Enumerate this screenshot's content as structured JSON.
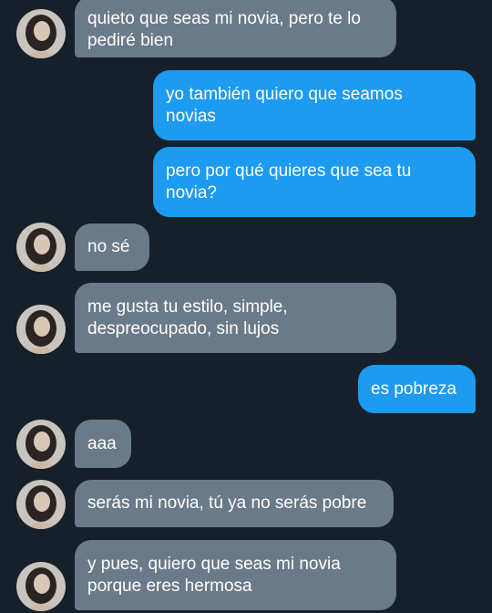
{
  "messages": [
    {
      "side": "received",
      "text": "quieto que seas mi novia, pero te lo\npediré bien"
    },
    {
      "side": "sent",
      "text": "yo también quiero que seamos\nnovias"
    },
    {
      "side": "sent",
      "text": "pero por qué quieres que sea tu\nnovia?"
    },
    {
      "side": "received",
      "text": "no sé"
    },
    {
      "side": "received",
      "text": "me gusta tu estilo, simple,\ndespreocupado, sin lujos"
    },
    {
      "side": "sent",
      "text": "es pobreza"
    },
    {
      "side": "received",
      "text": "aaa"
    },
    {
      "side": "received",
      "text": "serás mi novia, tú ya no serás pobre"
    },
    {
      "side": "received",
      "text": "y pues, quiero que seas mi novia\nporque eres hermosa"
    }
  ],
  "colors": {
    "background": "#15202b",
    "received_bubble": "#6b7a88",
    "sent_bubble": "#1d9bf0",
    "text": "#ffffff"
  },
  "avatar_icon": "user-avatar-photo"
}
